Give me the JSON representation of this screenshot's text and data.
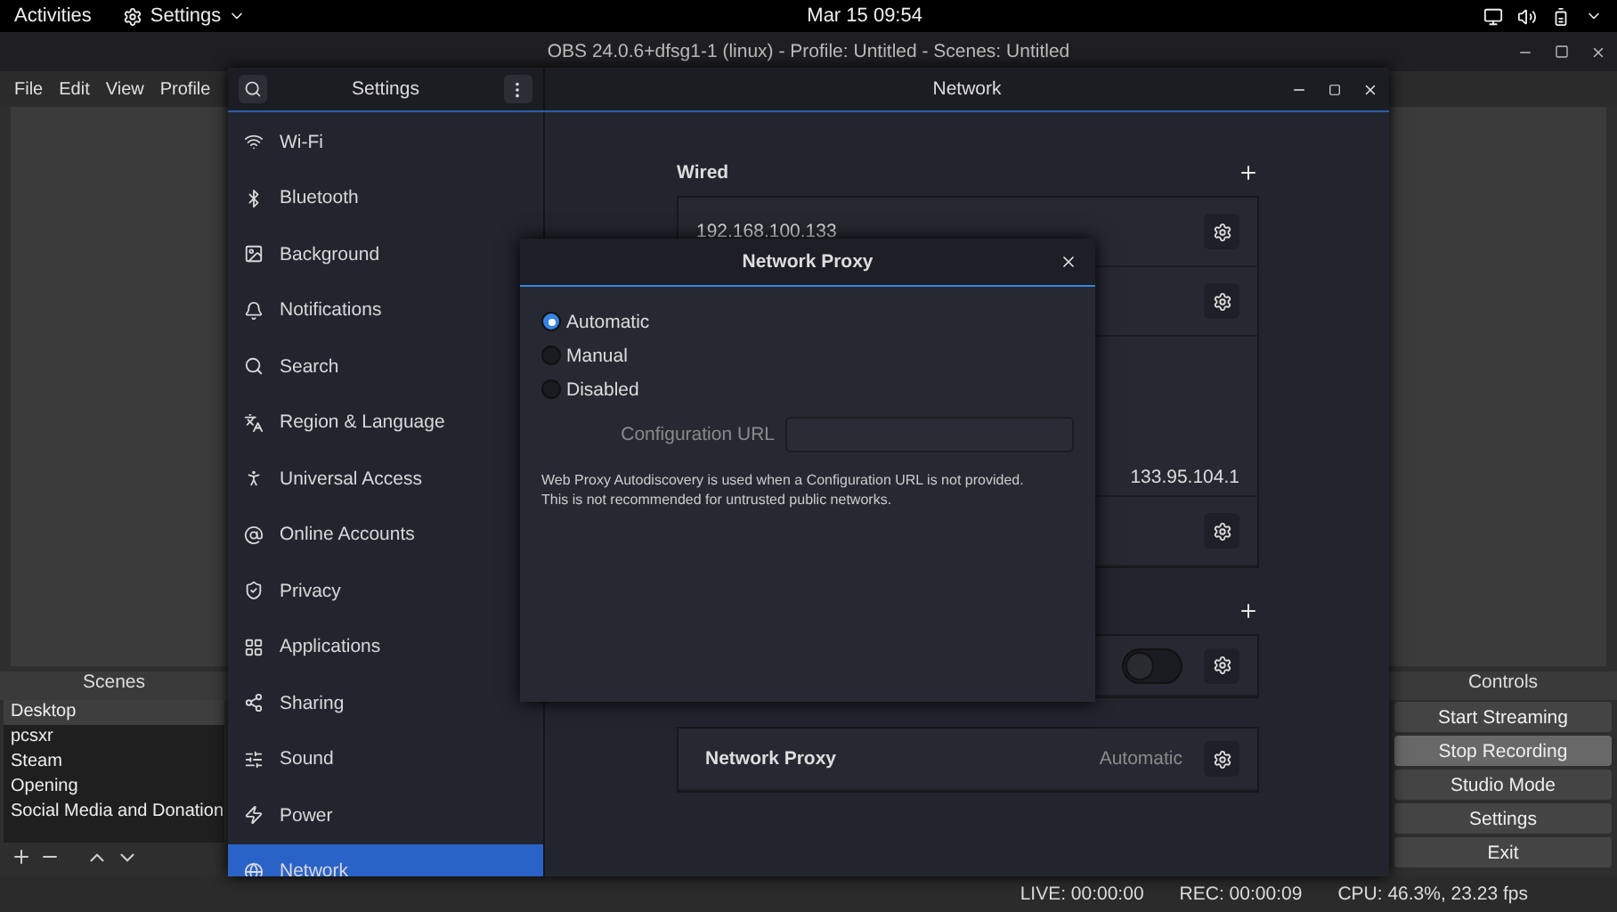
{
  "top_bar": {
    "activities": "Activities",
    "app_menu": "Settings",
    "clock": "Mar 15  09:54"
  },
  "obs": {
    "title": "OBS 24.0.6+dfsg1-1 (linux) - Profile: Untitled - Scenes: Untitled",
    "menu": [
      "File",
      "Edit",
      "View",
      "Profile"
    ],
    "scenes": {
      "title": "Scenes",
      "items": [
        {
          "label": "Desktop",
          "selected": true
        },
        {
          "label": "pcsxr",
          "selected": false
        },
        {
          "label": "Steam",
          "selected": false
        },
        {
          "label": "Opening",
          "selected": false
        },
        {
          "label": "Social Media and Donation",
          "selected": false
        }
      ]
    },
    "controls": {
      "title": "Controls",
      "buttons": [
        {
          "label": "Start Streaming",
          "highlighted": false
        },
        {
          "label": "Stop Recording",
          "highlighted": true
        },
        {
          "label": "Studio Mode",
          "highlighted": false
        },
        {
          "label": "Settings",
          "highlighted": false
        },
        {
          "label": "Exit",
          "highlighted": false
        }
      ]
    },
    "status_bar": [
      "LIVE: 00:00:00",
      "REC: 00:00:09",
      "CPU: 46.3%, 23.23 fps"
    ]
  },
  "settings": {
    "title": "Settings",
    "page_title": "Network",
    "sidebar": [
      {
        "label": "Wi-Fi",
        "selected": false
      },
      {
        "label": "Bluetooth",
        "selected": false
      },
      {
        "label": "Background",
        "selected": false
      },
      {
        "label": "Notifications",
        "selected": false
      },
      {
        "label": "Search",
        "selected": false
      },
      {
        "label": "Region & Language",
        "selected": false
      },
      {
        "label": "Universal Access",
        "selected": false
      },
      {
        "label": "Online Accounts",
        "selected": false
      },
      {
        "label": "Privacy",
        "selected": false
      },
      {
        "label": "Applications",
        "selected": false
      },
      {
        "label": "Sharing",
        "selected": false
      },
      {
        "label": "Sound",
        "selected": false
      },
      {
        "label": "Power",
        "selected": false
      },
      {
        "label": "Network",
        "selected": true
      }
    ],
    "wired": {
      "title": "Wired",
      "rows": [
        {
          "kind": "address",
          "label": "192.168.100.133"
        },
        {
          "kind": "gear"
        },
        {
          "kind": "detail",
          "value": "133.95.104.1"
        },
        {
          "kind": "gear"
        }
      ]
    },
    "vpn": {
      "toggle_on": false
    },
    "proxy": {
      "label": "Network Proxy",
      "value": "Automatic"
    }
  },
  "dialog": {
    "title": "Network Proxy",
    "options": [
      {
        "label": "Automatic",
        "selected": true
      },
      {
        "label": "Manual",
        "selected": false
      },
      {
        "label": "Disabled",
        "selected": false
      }
    ],
    "url_label": "Configuration URL",
    "note": "Web Proxy Autodiscovery is used when a Configuration URL is not provided.\nThis is not recommended for untrusted public networks."
  }
}
